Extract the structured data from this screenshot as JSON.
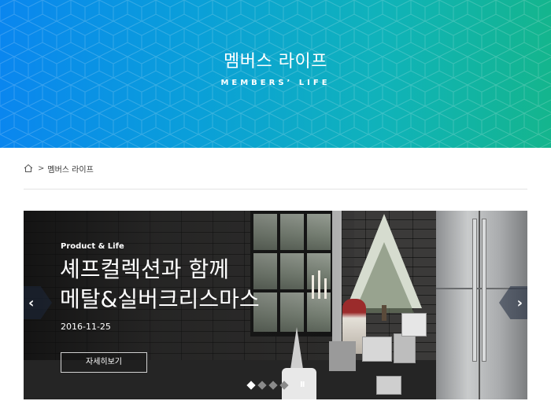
{
  "header": {
    "title": "멤버스 라이프",
    "subtitle": "MEMBERS’ LIFE",
    "gradient_start": "#0a86ef",
    "gradient_end": "#14b58d"
  },
  "breadcrumb": {
    "home_icon": "home-icon",
    "separator": ">",
    "current": "멤버스 라이프"
  },
  "slide": {
    "tag": "Product & Life",
    "title_line1": "셰프컬렉션과 함께",
    "title_line2": "메탈&실버크리스마스",
    "date": "2016-11-25",
    "detail_button": "자세히보기",
    "prev_arrow": "‹",
    "next_arrow": "›",
    "pause_label": "II",
    "total_slides": 4,
    "active_slide": 1
  }
}
